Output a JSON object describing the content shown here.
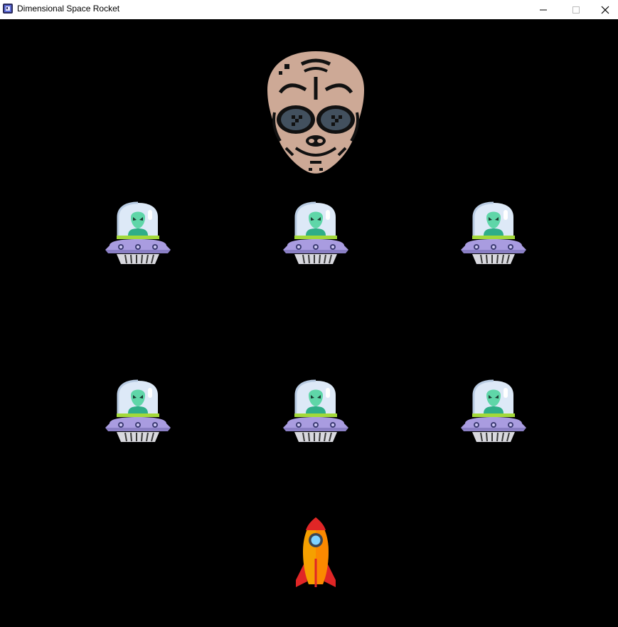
{
  "window": {
    "title": "Dimensional Space Rocket",
    "app_icon": "pygame-icon",
    "controls": [
      "minimize-icon",
      "maximize-icon",
      "close-icon"
    ]
  },
  "game": {
    "background_color": "#000000",
    "boss": {
      "type": "alien-head",
      "icon": "alien-head-icon",
      "skin_color": "#cda996"
    },
    "enemies": {
      "type": "alien-ufo",
      "icon": "ufo-icon",
      "rows": 2,
      "columns": 3,
      "count": 6
    },
    "player": {
      "type": "rocket",
      "icon": "rocket-icon",
      "body_color": "#f5a000"
    }
  }
}
